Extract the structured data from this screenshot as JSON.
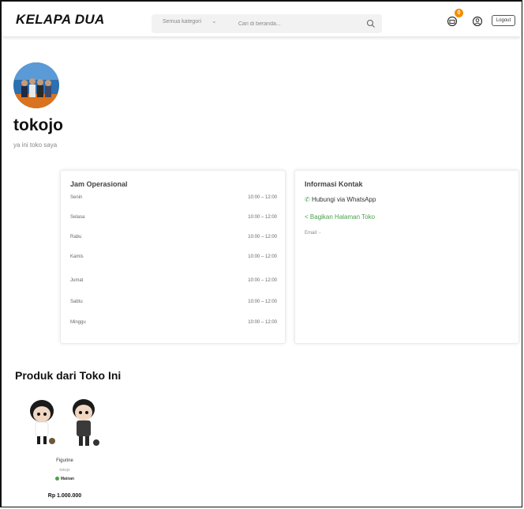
{
  "header": {
    "brand": "KELAPA DUA",
    "category_label": "Semua kategori",
    "search_placeholder": "Cari di beranda...",
    "cart_count": "0",
    "logout_label": "Logout"
  },
  "store": {
    "name": "tokojo",
    "description": "ya ini toko saya"
  },
  "hours": {
    "title": "Jam Operasional",
    "rows": [
      {
        "day": "Senin",
        "time": "10:00 – 12:00"
      },
      {
        "day": "Selasa",
        "time": "10:00 – 12:00"
      },
      {
        "day": "Rabu",
        "time": "10:00 – 12:00"
      },
      {
        "day": "Kamis",
        "time": "10:00 – 12:00"
      },
      {
        "day": "Jumat",
        "time": "10:00 – 12:00"
      },
      {
        "day": "Sabtu",
        "time": "10:00 – 12:00"
      },
      {
        "day": "Minggu",
        "time": "10:00 – 12:00"
      }
    ]
  },
  "contact": {
    "title": "Informasi Kontak",
    "whatsapp": "Hubungi via WhatsApp",
    "share": "Bagikan Halaman Toko",
    "email": "Email: -"
  },
  "products": {
    "title": "Produk dari Toko Ini",
    "items": [
      {
        "name": "Figurine",
        "store": "tokojo",
        "category": "Mainan",
        "price": "Rp 1.000.000"
      }
    ]
  },
  "colors": {
    "accent_green": "#4aa24a",
    "badge_orange": "#f28c00"
  },
  "icons": [
    "chevron-down-icon",
    "search-icon",
    "cart-icon",
    "user-icon",
    "whatsapp-icon",
    "share-icon"
  ]
}
